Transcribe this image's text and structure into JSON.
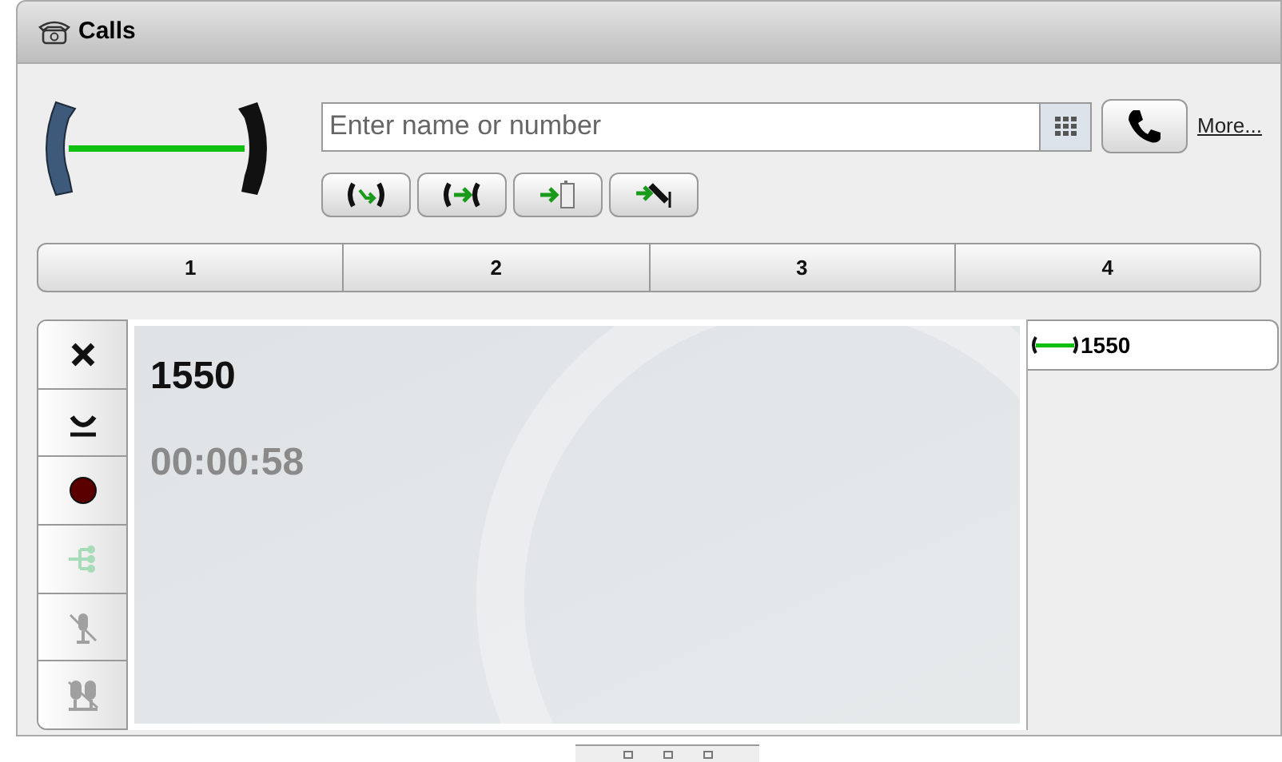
{
  "window": {
    "title": "Calls"
  },
  "dial": {
    "placeholder": "Enter name or number",
    "more_link": "More..."
  },
  "actions": [
    {
      "kind": "hold"
    },
    {
      "kind": "transfer"
    },
    {
      "kind": "to-device"
    },
    {
      "kind": "to-voicemail"
    }
  ],
  "tabs": [
    {
      "label": "1",
      "selected": false
    },
    {
      "label": "2",
      "selected": false
    },
    {
      "label": "3",
      "selected": false
    },
    {
      "label": "4",
      "selected": false
    }
  ],
  "side_buttons": [
    {
      "kind": "close",
      "disabled": false
    },
    {
      "kind": "hangup",
      "disabled": false
    },
    {
      "kind": "record",
      "disabled": false
    },
    {
      "kind": "conference",
      "disabled": true
    },
    {
      "kind": "mute",
      "disabled": true
    },
    {
      "kind": "mute-speaker",
      "disabled": true
    }
  ],
  "call": {
    "number": "1550",
    "duration": "00:00:58"
  },
  "call_list": [
    {
      "number": "1550"
    }
  ]
}
